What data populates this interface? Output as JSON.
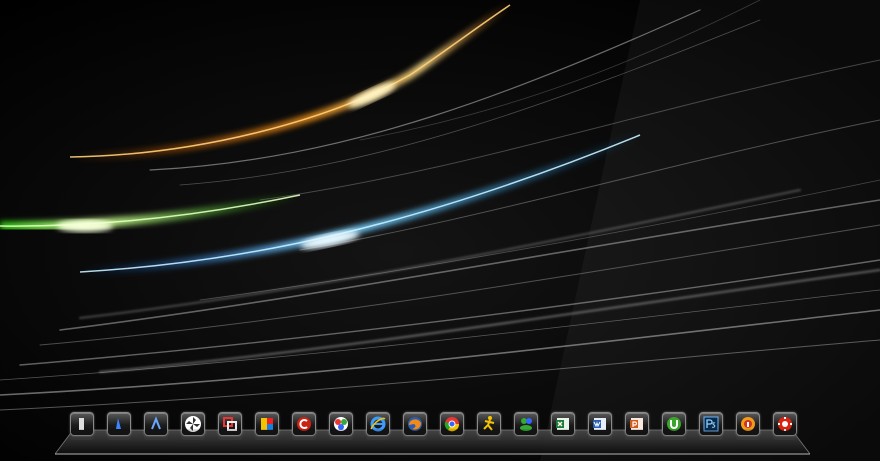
{
  "desktop": {
    "wallpaper": {
      "background": "#000000",
      "streak_colors": {
        "orange": "#ff8c1a",
        "green": "#39e61a",
        "blue": "#1aa3ff",
        "silver": "#d9d9d9"
      }
    }
  },
  "dock": {
    "icons": [
      {
        "name": "task-switcher-icon"
      },
      {
        "name": "hacker-app-icon"
      },
      {
        "name": "unknown-app-icon"
      },
      {
        "name": "pinwheel-app-icon"
      },
      {
        "name": "media-converter-icon"
      },
      {
        "name": "colorful-app-icon"
      },
      {
        "name": "ccleaner-icon"
      },
      {
        "name": "picasa-icon"
      },
      {
        "name": "internet-explorer-icon"
      },
      {
        "name": "firefox-icon"
      },
      {
        "name": "chrome-icon"
      },
      {
        "name": "aim-icon"
      },
      {
        "name": "messenger-icon"
      },
      {
        "name": "excel-icon"
      },
      {
        "name": "word-icon"
      },
      {
        "name": "powerpoint-icon"
      },
      {
        "name": "utorrent-icon"
      },
      {
        "name": "photoshop-icon"
      },
      {
        "name": "info-app-icon"
      },
      {
        "name": "red-gear-app-icon"
      }
    ]
  }
}
